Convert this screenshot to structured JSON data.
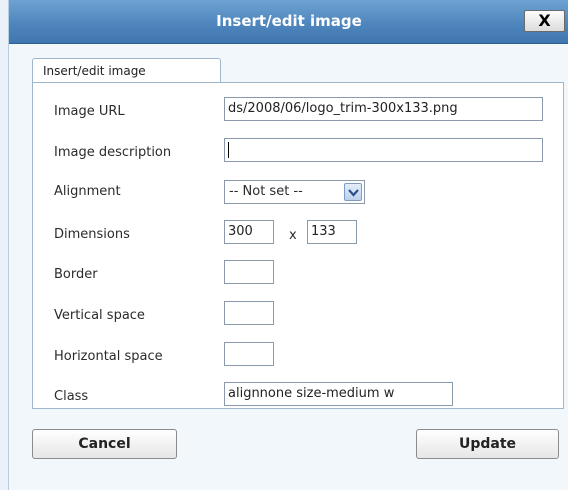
{
  "dialog": {
    "title": "Insert/edit image",
    "close_label": "X",
    "tab_label": "Insert/edit image"
  },
  "form": {
    "image_url_label": "Image URL",
    "image_url_value": "ds/2008/06/logo_trim-300x133.png",
    "image_description_label": "Image description",
    "image_description_value": "",
    "alignment_label": "Alignment",
    "alignment_value": "-- Not set --",
    "dimensions_label": "Dimensions",
    "width_value": "300",
    "dimension_separator": "x",
    "height_value": "133",
    "border_label": "Border",
    "border_value": "",
    "vertical_space_label": "Vertical space",
    "vertical_space_value": "",
    "horizontal_space_label": "Horizontal space",
    "horizontal_space_value": "",
    "class_label": "Class",
    "class_value": "alignnone size-medium w"
  },
  "buttons": {
    "cancel_label": "Cancel",
    "update_label": "Update"
  }
}
